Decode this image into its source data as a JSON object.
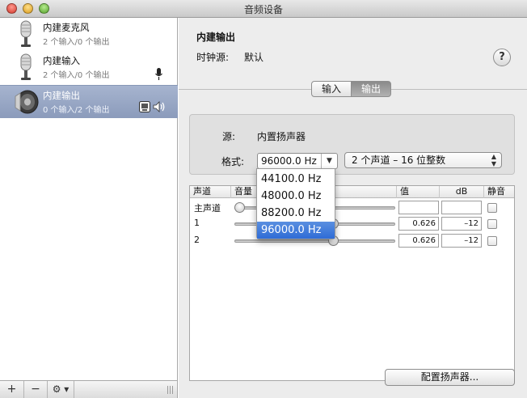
{
  "window": {
    "title": "音频设备"
  },
  "devices": [
    {
      "name": "内建麦克风",
      "sub": "2 个输入/0 个输出",
      "icon": "microphone-icon"
    },
    {
      "name": "内建输入",
      "sub": "2 个输入/0 个输出",
      "icon": "microphone-icon",
      "badge": "microphone-default-input-icon"
    },
    {
      "name": "内建输出",
      "sub": "0 个输入/2 个输出",
      "icon": "speaker-icon",
      "badges": [
        "finder-system-output-icon",
        "speaker-volume-icon"
      ]
    }
  ],
  "toolbar": {
    "add": "+",
    "remove": "−",
    "gear": "⚙ ▾"
  },
  "detail": {
    "device_title": "内建输出",
    "clock_label": "时钟源:",
    "clock_value": "默认",
    "help": "?",
    "tabs": [
      "输入",
      "输出"
    ],
    "source_label": "源:",
    "source_value": "内置扬声器",
    "format_label": "格式:",
    "format_value": "96000.0 Hz",
    "channels_value": "2 个声道 – 16 位整数"
  },
  "table": {
    "headers": {
      "channel": "声道",
      "volume": "音量",
      "value": "值",
      "db": "dB",
      "mute": "静音"
    },
    "rows": [
      {
        "name": "主声道",
        "value": "",
        "db": "",
        "level": 0.0
      },
      {
        "name": "1",
        "value": "0.626",
        "db": "–12",
        "level": 0.626
      },
      {
        "name": "2",
        "value": "0.626",
        "db": "–12",
        "level": 0.626
      }
    ]
  },
  "format_menu": [
    "44100.0 Hz",
    "48000.0 Hz",
    "88200.0 Hz",
    "96000.0 Hz"
  ],
  "format_menu_selected": "96000.0 Hz",
  "configure_button": "配置扬声器..."
}
